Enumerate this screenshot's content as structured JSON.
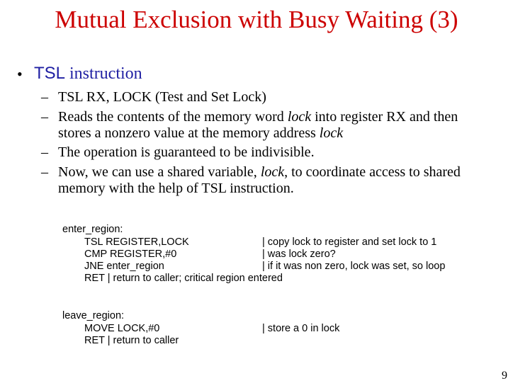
{
  "title": "Mutual Exclusion with Busy Waiting (3)",
  "bullet": {
    "marker": "•",
    "keyword": "TSL",
    "rest": " instruction"
  },
  "subitems": [
    {
      "dash": "–",
      "line1": "TSL RX, LOCK (Test and Set Lock)"
    },
    {
      "dash": "–",
      "line1_a": "Reads the contents of the memory word ",
      "line1_em": "lock",
      "line1_b": " into register RX and then",
      "line2_a": "stores a nonzero value at the memory address ",
      "line2_em": "lock"
    },
    {
      "dash": "–",
      "line1": "The operation is guaranteed to be indivisible."
    },
    {
      "dash": "–",
      "line1_a": "Now, we can use a shared variable, ",
      "line1_em": "lock",
      "line1_b": ", to coordinate access to shared",
      "line2": "memory with the help of TSL instruction."
    }
  ],
  "code": {
    "enter_label": "enter_region:",
    "enter_lines": [
      {
        "instr": "TSL REGISTER,LOCK",
        "comment": "| copy lock to register and set lock to 1"
      },
      {
        "instr": "CMP REGISTER,#0",
        "comment": "| was lock zero?"
      },
      {
        "instr": "JNE enter_region",
        "comment": "| if it was non zero, lock was set, so loop"
      },
      {
        "instr": "RET | return to caller; critical region entered",
        "comment": ""
      }
    ],
    "leave_label": "leave_region:",
    "leave_lines": [
      {
        "instr": "MOVE LOCK,#0",
        "comment": "| store a 0 in lock"
      },
      {
        "instr": "RET | return to caller",
        "comment": ""
      }
    ]
  },
  "page_number": "9"
}
